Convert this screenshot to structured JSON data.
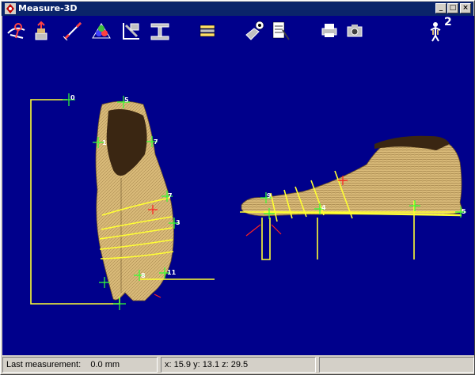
{
  "window": {
    "title": "Measure-3D"
  },
  "window_controls": {
    "minimize": "_",
    "maximize": "□",
    "close": "×"
  },
  "toolbar": {
    "tools": [
      "eye-measure-icon",
      "stand-upload-icon",
      "line-measure-icon",
      "flower-mesh-icon",
      "view-angle-icon",
      "ruler-section-icon",
      "layers-icon",
      "hand-info-icon",
      "notepad-icon",
      "printer-icon",
      "camera-icon",
      "person-2-icon"
    ],
    "person_badge": "2"
  },
  "scene": {
    "background_color": "#00008b",
    "foot_color": "#d8b978",
    "line_color": "#ffff33",
    "marker_color": "#33ff33",
    "landmark_labels": [
      "0",
      "5",
      "1",
      "7",
      "7",
      "3",
      "11",
      "8",
      "9",
      "4",
      "5"
    ]
  },
  "status": {
    "last_measurement": "Last measurement:    0.0 mm",
    "coords": "x: 15.9 y: 13.1 z: 29.5",
    "extra": ""
  }
}
